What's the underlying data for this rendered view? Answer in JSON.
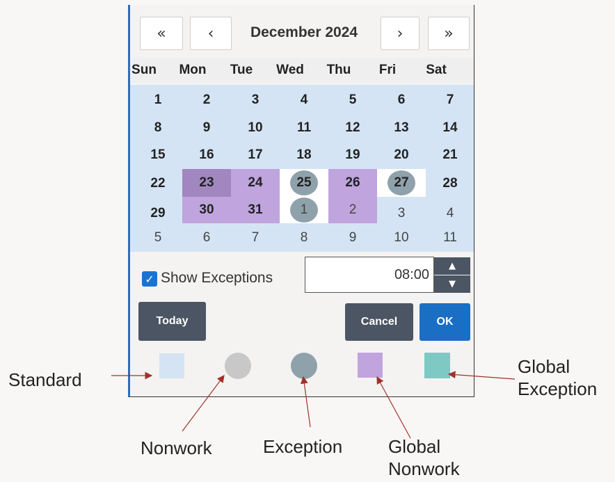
{
  "calendar": {
    "month_title": "December 2024",
    "nav": {
      "prev_year": "«",
      "prev_month": "‹",
      "next_month": "›",
      "next_year": "»"
    },
    "weekdays": [
      "Sun",
      "Mon",
      "Tue",
      "Wed",
      "Thu",
      "Fri",
      "Sat"
    ],
    "weeks": [
      [
        "1",
        "2",
        "3",
        "4",
        "5",
        "6",
        "7"
      ],
      [
        "8",
        "9",
        "10",
        "11",
        "12",
        "13",
        "14"
      ],
      [
        "15",
        "16",
        "17",
        "18",
        "19",
        "20",
        "21"
      ],
      [
        "22",
        "23",
        "24",
        "25",
        "26",
        "27",
        "28"
      ],
      [
        "29",
        "30",
        "31",
        "1",
        "2",
        "3",
        "4"
      ],
      [
        "5",
        "6",
        "7",
        "8",
        "9",
        "10",
        "11"
      ]
    ]
  },
  "controls": {
    "show_exceptions_label": "Show Exceptions",
    "show_exceptions_checked": true,
    "time_value": "08:00",
    "spin_up": "▲",
    "spin_down": "▼",
    "today_label": "Today",
    "cancel_label": "Cancel",
    "ok_label": "OK"
  },
  "legend": {
    "standard": "Standard",
    "nonwork": "Nonwork",
    "exception": "Exception",
    "global_nonwork_line1": "Global",
    "global_nonwork_line2": "Nonwork",
    "global_exception_line1": "Global",
    "global_exception_line2": "Exception"
  },
  "colors": {
    "standard": "#d4e4f4",
    "nonwork": "#c8c8c8",
    "exception": "#8fa1aa",
    "global_nonwork": "#c0a4de",
    "global_exception": "#7ec9c4",
    "ok_button": "#1a6fc4",
    "dark_button": "#4b5563",
    "callout_arrow": "#a0322a"
  }
}
